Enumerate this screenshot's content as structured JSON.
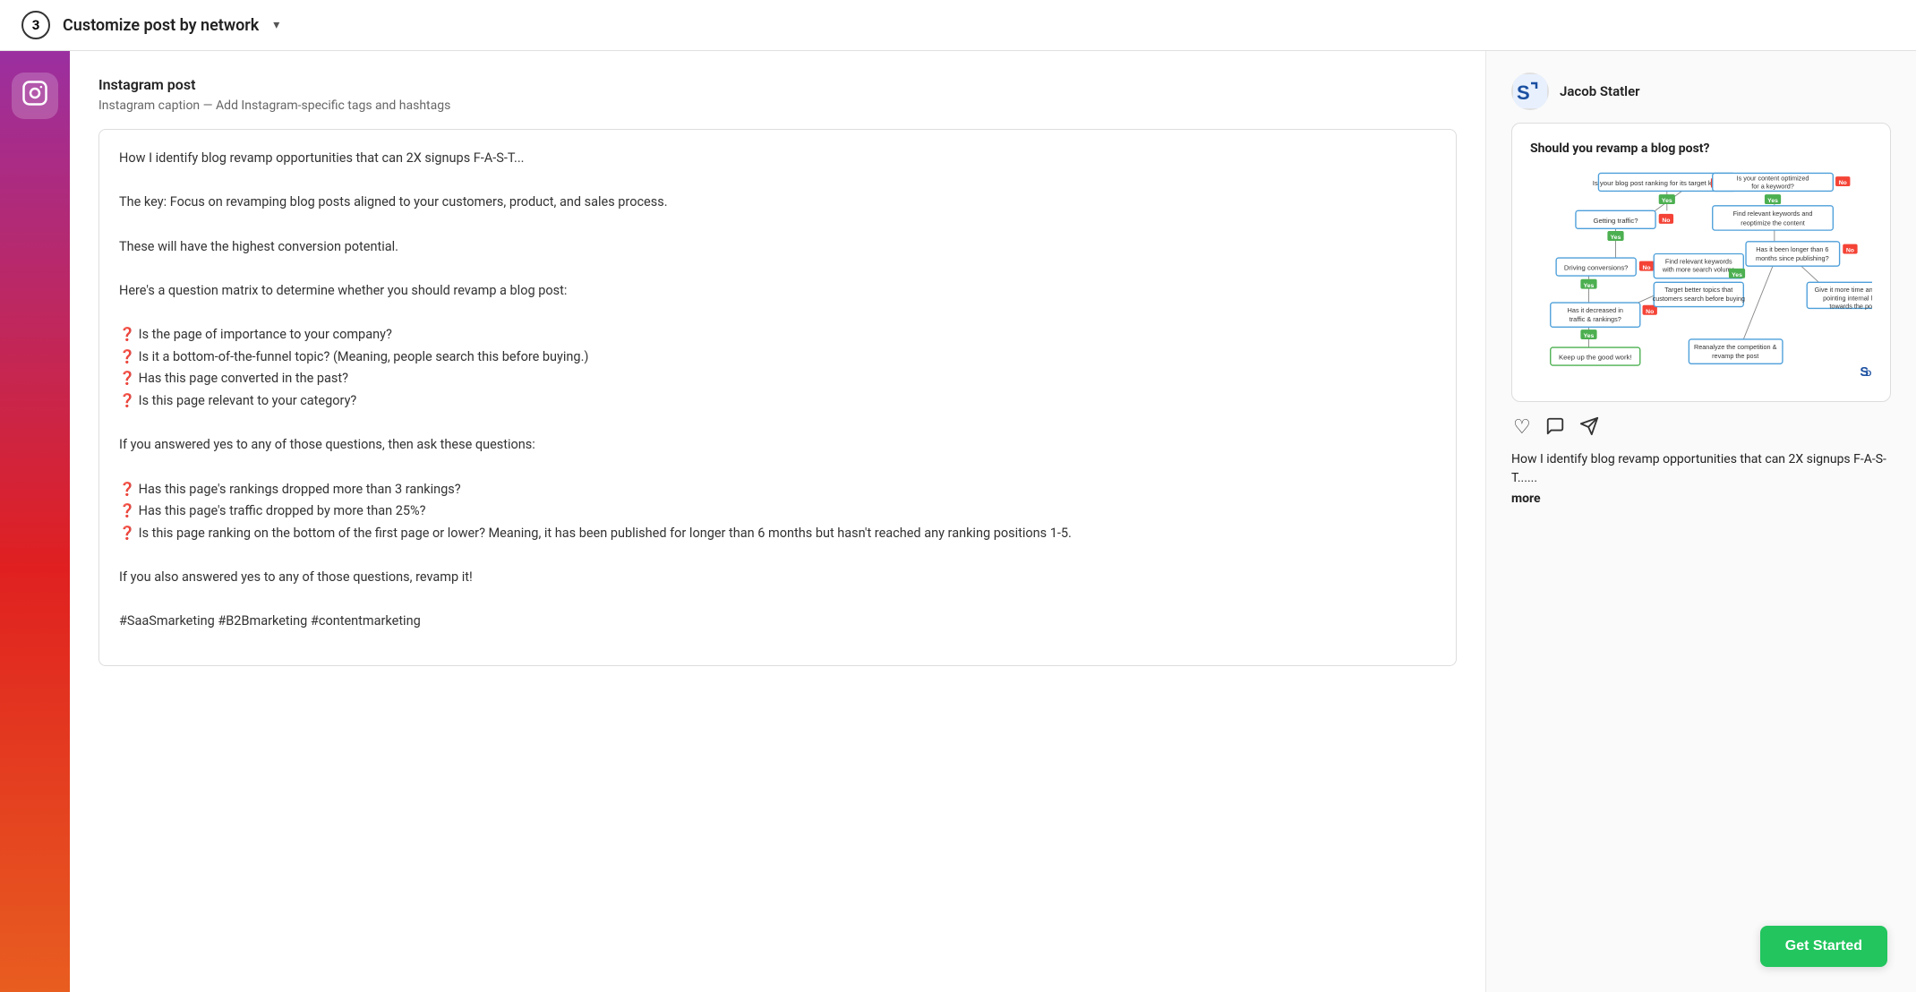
{
  "header": {
    "step": "3",
    "title": "Customize post by network",
    "chevron": "▾"
  },
  "sidebar": {
    "icon": "instagram"
  },
  "editor": {
    "panel_title": "Instagram post",
    "panel_subtitle": "Instagram caption — Add Instagram-specific tags and hashtags",
    "content": "How I identify blog revamp opportunities that can 2X signups F-A-S-T...\n\nThe key: Focus on revamping blog posts aligned to your customers, product, and sales process.\n\nThese will have the highest conversion potential.\n\nHere's a question matrix to determine whether you should revamp a blog post:\n\n❓ Is the page of importance to your company?\n❓ Is it a bottom-of-the-funnel topic? (Meaning, people search this before buying.)\n❓ Has this page converted in the past?\n❓ Is this page relevant to your category?\n\nIf you answered yes to any of those questions, then ask these questions:\n\n❓ Has this page's rankings dropped more than 3 rankings?\n❓ Has this page's traffic dropped by more than 25%?\n❓ Is this page ranking on the bottom of the first page or lower? Meaning, it has been published for longer than 6 months but hasn't reached any ranking positions 1-5.\n\nIf you also answered yes to any of those questions, revamp it!\n\n#SaaSmarketing #B2Bmarketing #contentmarketing"
  },
  "preview": {
    "username": "Jacob Statler",
    "flowchart": {
      "title": "Should you revamp a blog post?",
      "nodes": [
        {
          "id": "n1",
          "text": "Is your blog post ranking for its target keywords?"
        },
        {
          "id": "n2",
          "text": "Getting traffic?"
        },
        {
          "id": "n3",
          "text": "Is your content optimized for a keyword?"
        },
        {
          "id": "n4",
          "text": "Driving conversions?"
        },
        {
          "id": "n5",
          "text": "Find relevant keywords with more search volume"
        },
        {
          "id": "n6",
          "text": "Find relevant keywords and reoptimize the content"
        },
        {
          "id": "n7",
          "text": "Has it decreased in traffic & rankings?"
        },
        {
          "id": "n8",
          "text": "Target better topics that customers search before buying"
        },
        {
          "id": "n9",
          "text": "Has it been longer than 6 months since publishing?"
        },
        {
          "id": "n10",
          "text": "Keep up the good work!"
        },
        {
          "id": "n11",
          "text": "Give it more time and keep pointing internal links towards the post"
        },
        {
          "id": "n12",
          "text": "Reanalyze the competition & revamp the post"
        }
      ]
    },
    "caption_short": "How I identify blog revamp opportunities that can 2X signups F-A-S-T......",
    "more_label": "more",
    "actions": {
      "heart": "♡",
      "comment": "💬",
      "share": "➤"
    }
  },
  "cta": {
    "label": "Get Started"
  }
}
